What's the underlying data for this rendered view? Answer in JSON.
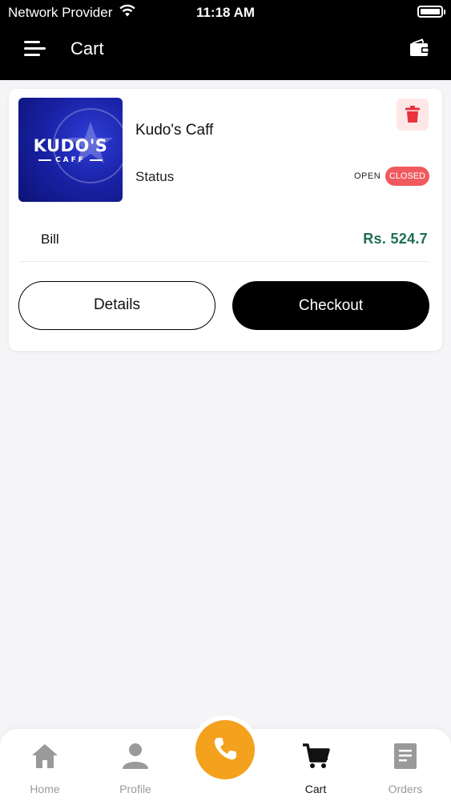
{
  "status_bar": {
    "carrier": "Network Provider",
    "time": "11:18 AM"
  },
  "header": {
    "title": "Cart",
    "menu_icon": "menu-icon",
    "wallet_icon": "wallet-icon"
  },
  "cart_item": {
    "shop_name": "Kudo's Caff",
    "logo": {
      "brand": "KUDO'S",
      "sub": "CAFF"
    },
    "status_label": "Status",
    "open_label": "OPEN",
    "closed_label": "CLOSED",
    "bill_label": "Bill",
    "bill_amount": "Rs. 524.7",
    "details_label": "Details",
    "checkout_label": "Checkout"
  },
  "nav": {
    "items": [
      {
        "label": "Home",
        "icon": "home-icon"
      },
      {
        "label": "Profile",
        "icon": "profile-icon"
      },
      {
        "label": "Cart",
        "icon": "cart-icon",
        "active": true
      },
      {
        "label": "Orders",
        "icon": "orders-icon"
      }
    ],
    "fab_icon": "phone-icon"
  },
  "colors": {
    "accent": "#f4a11d",
    "closed": "#ef5a5f",
    "bill": "#1f6e51",
    "delete_bg": "#ffe7e8",
    "delete_icon": "#e8323c"
  }
}
